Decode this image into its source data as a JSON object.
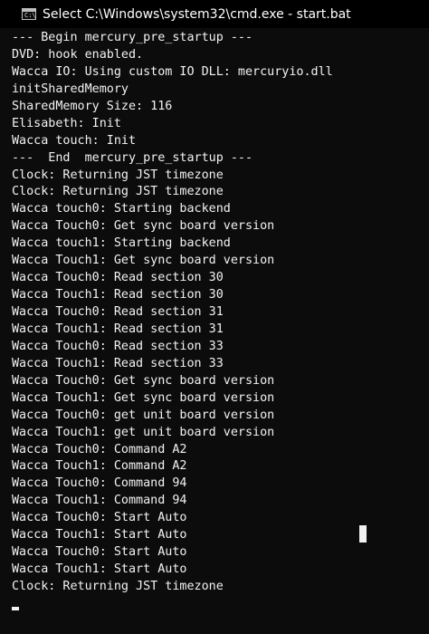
{
  "window": {
    "title": "Select C:\\Windows\\system32\\cmd.exe - start.bat",
    "icon_name": "cmd-icon",
    "icon_text": "C:\\"
  },
  "colors": {
    "background": "#0c0c0c",
    "titlebar": "#000000",
    "text": "#f2f2f2"
  },
  "console": {
    "lines": [
      "--- Begin mercury_pre_startup ---",
      "DVD: hook enabled.",
      "Wacca IO: Using custom IO DLL: mercuryio.dll",
      "initSharedMemory",
      "SharedMemory Size: 116",
      "Elisabeth: Init",
      "Wacca touch: Init",
      "---  End  mercury_pre_startup ---",
      "Clock: Returning JST timezone",
      "Clock: Returning JST timezone",
      "Wacca touch0: Starting backend",
      "Wacca Touch0: Get sync board version",
      "Wacca touch1: Starting backend",
      "Wacca Touch1: Get sync board version",
      "Wacca Touch0: Read section 30",
      "Wacca Touch1: Read section 30",
      "Wacca Touch0: Read section 31",
      "Wacca Touch1: Read section 31",
      "Wacca Touch0: Read section 33",
      "Wacca Touch1: Read section 33",
      "Wacca Touch0: Get sync board version",
      "Wacca Touch1: Get sync board version",
      "Wacca Touch0: get unit board version",
      "Wacca Touch1: get unit board version",
      "Wacca Touch0: Command A2",
      "Wacca Touch1: Command A2",
      "Wacca Touch0: Command 94",
      "Wacca Touch1: Command 94",
      "Wacca Touch0: Start Auto",
      "Wacca Touch1: Start Auto",
      "Wacca Touch0: Start Auto",
      "Wacca Touch1: Start Auto",
      "Clock: Returning JST timezone"
    ]
  }
}
